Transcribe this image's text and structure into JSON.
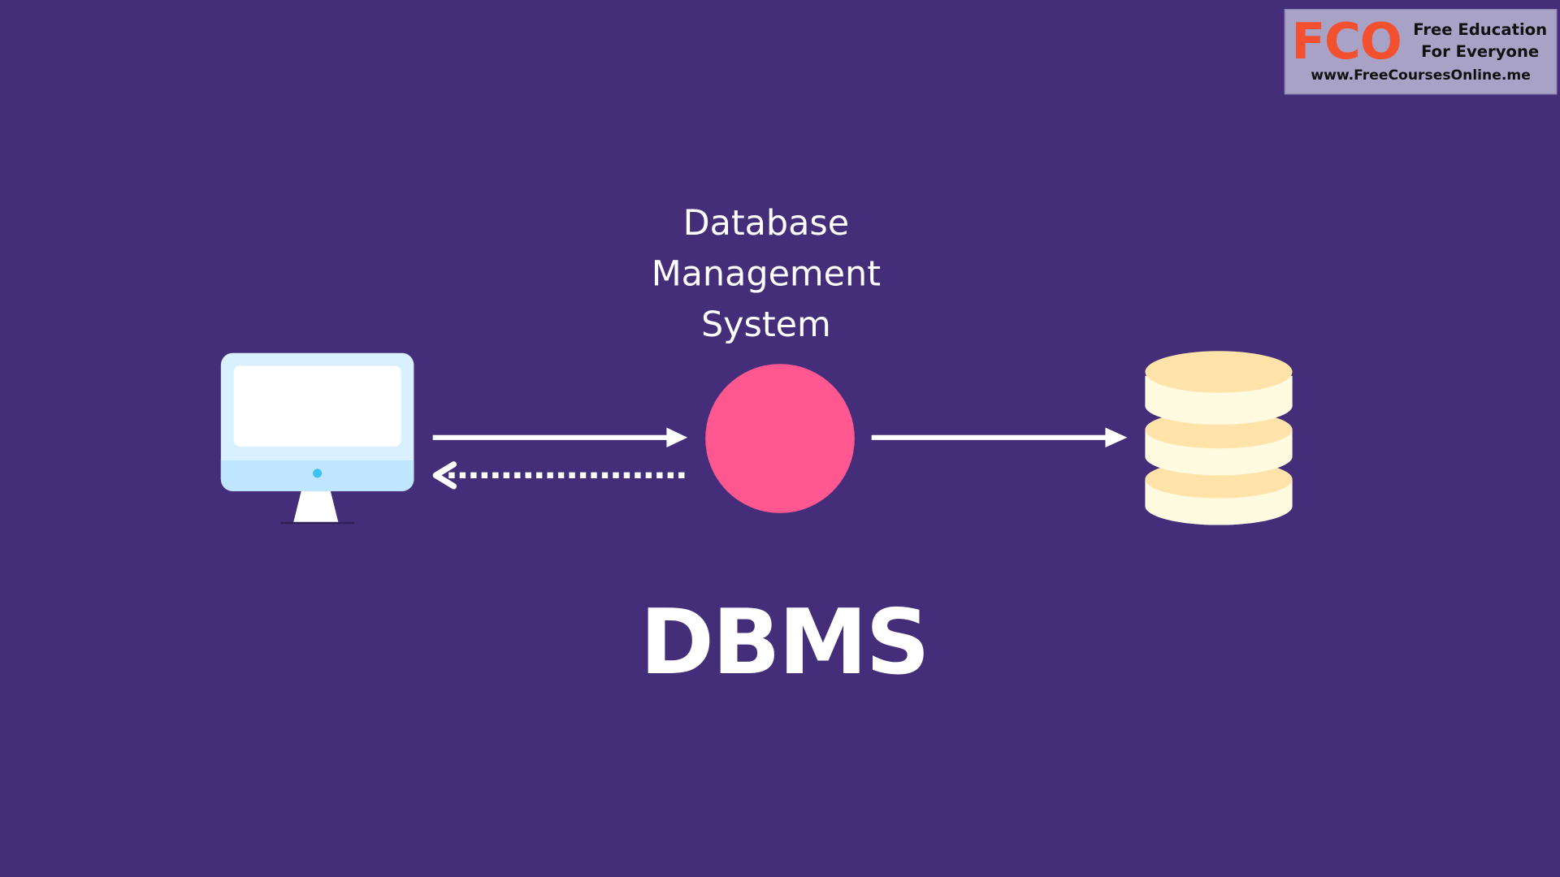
{
  "watermark": {
    "logo": "FCO",
    "tagline_line1": "Free Education",
    "tagline_line2": "For Everyone",
    "url": "www.FreeCoursesOnline.me"
  },
  "diagram": {
    "dbms_label_lines": [
      "Database",
      "Management",
      "System"
    ],
    "title": "DBMS",
    "nodes": [
      {
        "id": "computer",
        "icon": "computer-monitor-icon"
      },
      {
        "id": "dbms",
        "icon": "circle-node"
      },
      {
        "id": "database",
        "icon": "database-stack-icon"
      }
    ],
    "edges": [
      {
        "from": "computer",
        "to": "dbms",
        "style": "solid"
      },
      {
        "from": "dbms",
        "to": "computer",
        "style": "dotted"
      },
      {
        "from": "dbms",
        "to": "database",
        "style": "solid"
      }
    ]
  },
  "colors": {
    "background": "#442e79",
    "dbms_node": "#ff5890",
    "arrow": "#ffffff",
    "monitor_frame": "#d9f1ff",
    "monitor_screen": "#ffffff",
    "monitor_chin": "#bfe5ff",
    "power_led": "#3ec1f3",
    "database_side": "#fffbe1",
    "database_top": "#ffe3a9",
    "logo_text": "#f2502f"
  }
}
